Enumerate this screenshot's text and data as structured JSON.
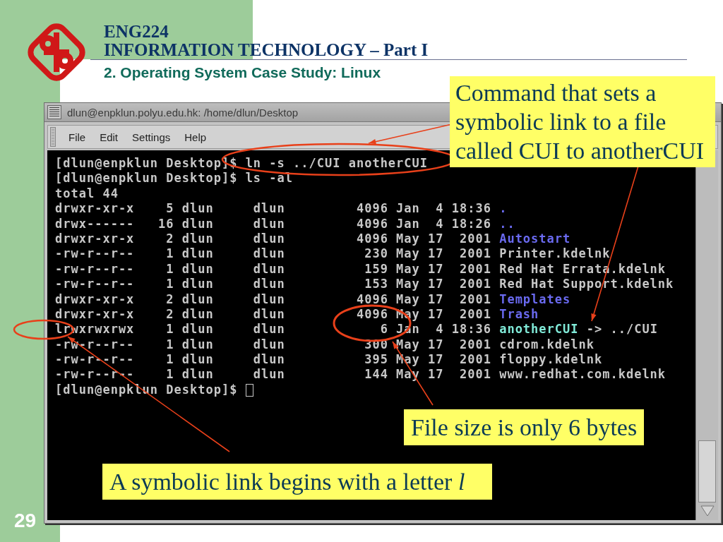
{
  "slide": {
    "course": "ENG224",
    "title": "INFORMATION TECHNOLOGY – Part I",
    "subtitle": "2. Operating System Case Study: Linux",
    "page_number": "29"
  },
  "window": {
    "title": "dlun@enpklun.polyu.edu.hk: /home/dlun/Desktop",
    "menu": [
      "File",
      "Edit",
      "Settings",
      "Help"
    ]
  },
  "terminal": {
    "lines": [
      {
        "kind": "text",
        "text": "[dlun@enpklun Desktop]$ ln -s ../CUI anotherCUI"
      },
      {
        "kind": "text",
        "text": "[dlun@enpklun Desktop]$ ls -al"
      },
      {
        "kind": "text",
        "text": "total 44"
      },
      {
        "kind": "directory",
        "info": "drwxr-xr-x    5 dlun     dlun         4096 Jan  4 18:36",
        "name": "."
      },
      {
        "kind": "directory",
        "info": "drwx------   16 dlun     dlun         4096 Jan  4 18:26",
        "name": ".."
      },
      {
        "kind": "directory",
        "info": "drwxr-xr-x    2 dlun     dlun         4096 May 17  2001",
        "name": "Autostart"
      },
      {
        "kind": "file",
        "info": "-rw-r--r--    1 dlun     dlun          230 May 17  2001",
        "name": "Printer.kdelnk"
      },
      {
        "kind": "file",
        "info": "-rw-r--r--    1 dlun     dlun          159 May 17  2001",
        "name": "Red Hat Errata.kdelnk"
      },
      {
        "kind": "file",
        "info": "-rw-r--r--    1 dlun     dlun          153 May 17  2001",
        "name": "Red Hat Support.kdelnk"
      },
      {
        "kind": "directory",
        "info": "drwxr-xr-x    2 dlun     dlun         4096 May 17  2001",
        "name": "Templates"
      },
      {
        "kind": "directory",
        "info": "drwxr-xr-x    2 dlun     dlun         4096 May 17  2001",
        "name": "Trash"
      },
      {
        "kind": "link",
        "info": "lrwxrwxrwx    1 dlun     dlun            6 Jan  4 18:36",
        "name": "anotherCUI",
        "target": "-> ../CUI"
      },
      {
        "kind": "file",
        "info": "-rw-r--r--    1 dlun     dlun          300 May 17  2001",
        "name": "cdrom.kdelnk"
      },
      {
        "kind": "file",
        "info": "-rw-r--r--    1 dlun     dlun          395 May 17  2001",
        "name": "floppy.kdelnk"
      },
      {
        "kind": "file",
        "info": "-rw-r--r--    1 dlun     dlun          144 May 17  2001",
        "name": "www.redhat.com.kdelnk"
      },
      {
        "kind": "prompt",
        "text": "[dlun@enpklun Desktop]$"
      }
    ]
  },
  "callouts": [
    {
      "text": "Command that sets a symbolic link to a file called CUI to anotherCUI"
    },
    {
      "text": "File size is only 6 bytes"
    },
    {
      "text": "A symbolic link begins with a letter *l*"
    }
  ]
}
